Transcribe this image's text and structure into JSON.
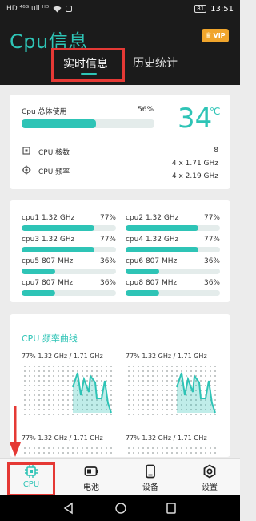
{
  "status_bar": {
    "left": "HD ⁴⁶ᴳ ull ᴴᴰ",
    "battery": "81",
    "time": "13:51"
  },
  "header": {
    "title": "Cpu信息",
    "vip_label": "VIP",
    "tabs": [
      {
        "label": "实时信息",
        "active": true
      },
      {
        "label": "历史统计",
        "active": false
      }
    ]
  },
  "overview": {
    "usage_label": "Cpu 总体使用",
    "usage_percent": "56%",
    "usage_fraction": 0.56,
    "temperature": "34",
    "temperature_unit": "℃",
    "core_count_label": "CPU 核数",
    "core_count": "8",
    "freq_label": "CPU 频率",
    "freq_values": [
      "4 x 1.71 GHz",
      "4 x 2.19 GHz"
    ]
  },
  "cores": [
    {
      "name": "cpu1  1.32 GHz",
      "pct": "77%",
      "fraction": 0.77
    },
    {
      "name": "cpu2  1.32 GHz",
      "pct": "77%",
      "fraction": 0.77
    },
    {
      "name": "cpu3  1.32 GHz",
      "pct": "77%",
      "fraction": 0.77
    },
    {
      "name": "cpu4  1.32 GHz",
      "pct": "77%",
      "fraction": 0.77
    },
    {
      "name": "cpu5  807 MHz",
      "pct": "36%",
      "fraction": 0.36
    },
    {
      "name": "cpu6  807 MHz",
      "pct": "36%",
      "fraction": 0.36
    },
    {
      "name": "cpu7  807 MHz",
      "pct": "36%",
      "fraction": 0.36
    },
    {
      "name": "cpu8  807 MHz",
      "pct": "36%",
      "fraction": 0.36
    }
  ],
  "curves": {
    "title": "CPU 频率曲线",
    "graphs": [
      {
        "label": "77% 1.32 GHz / 1.71 GHz"
      },
      {
        "label": "77% 1.32 GHz / 1.71 GHz"
      },
      {
        "label": "77% 1.32 GHz / 1.71 GHz"
      },
      {
        "label": "77% 1.32 GHz / 1.71 GHz"
      }
    ]
  },
  "bottom_nav": [
    {
      "label": "CPU",
      "icon": "chip-icon",
      "active": true
    },
    {
      "label": "电池",
      "icon": "battery-icon",
      "active": false
    },
    {
      "label": "设备",
      "icon": "phone-icon",
      "active": false
    },
    {
      "label": "设置",
      "icon": "settings-icon",
      "active": false
    }
  ],
  "colors": {
    "accent": "#2ec4b6",
    "header_bg": "#1b1b1b",
    "annotation": "#e53935",
    "vip": "#f0a52c"
  }
}
